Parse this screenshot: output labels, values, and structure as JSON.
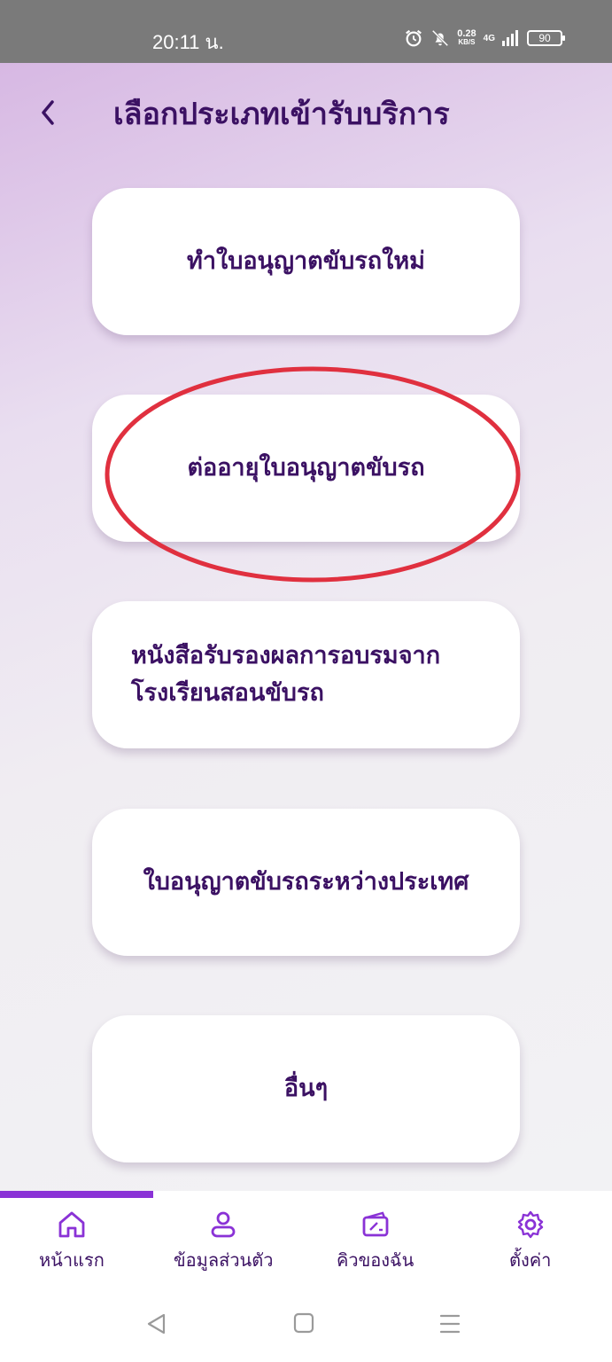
{
  "status_bar": {
    "time": "20:11 น.",
    "speed_value": "0.28",
    "speed_unit": "KB/S",
    "network": "4G",
    "battery": "90"
  },
  "header": {
    "title": "เลือกประเภทเข้ารับบริการ"
  },
  "options": [
    {
      "label": "ทำใบอนุญาตขับรถใหม่"
    },
    {
      "label": "ต่ออายุใบอนุญาตขับรถ",
      "highlighted": true
    },
    {
      "label_line1": "หนังสือรับรองผลการอบรมจาก",
      "label_line2": "โรงเรียนสอนขับรถ"
    },
    {
      "label": "ใบอนุญาตขับรถระหว่างประเทศ"
    },
    {
      "label": "อื่นๆ"
    }
  ],
  "bottom_nav": {
    "items": [
      {
        "label": "หน้าแรก",
        "icon": "home-icon",
        "active": true
      },
      {
        "label": "ข้อมูลส่วนตัว",
        "icon": "user-icon"
      },
      {
        "label": "คิวของฉัน",
        "icon": "ticket-icon"
      },
      {
        "label": "ตั้งค่า",
        "icon": "gear-icon"
      }
    ]
  },
  "colors": {
    "accent": "#8a32d6",
    "text_dark": "#3b1163",
    "highlight": "#e0303f"
  }
}
